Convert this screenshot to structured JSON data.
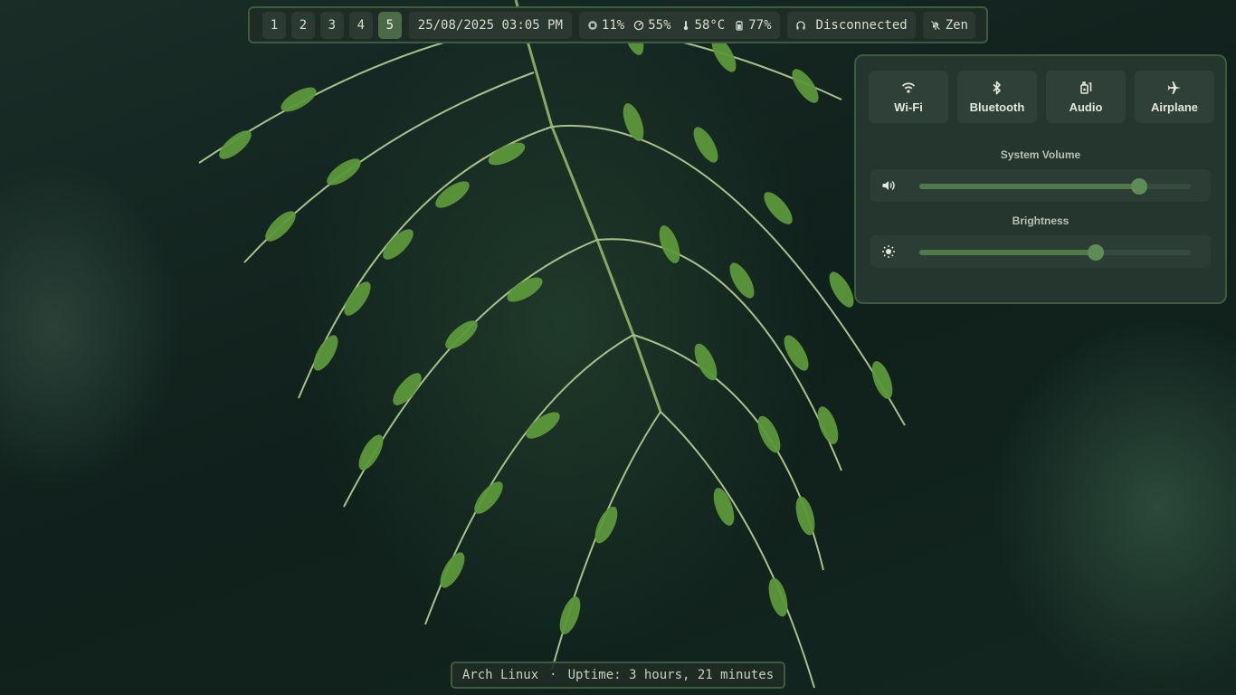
{
  "workspaces": [
    {
      "label": "1",
      "active": false
    },
    {
      "label": "2",
      "active": false
    },
    {
      "label": "3",
      "active": false
    },
    {
      "label": "4",
      "active": false
    },
    {
      "label": "5",
      "active": true
    }
  ],
  "clock": "25/08/2025 03:05 PM",
  "stats": {
    "cpu": {
      "icon": "cpu-icon",
      "value": "11%"
    },
    "memory": {
      "icon": "gauge-icon",
      "value": "55%"
    },
    "temperature": {
      "icon": "thermometer-icon",
      "value": "58°C"
    },
    "battery": {
      "icon": "battery-icon",
      "value": "77%"
    }
  },
  "headset": {
    "icon": "headphones-icon",
    "label": "Disconnected"
  },
  "notifications": {
    "icon": "bell-off-icon",
    "label": "Zen"
  },
  "quick_settings": {
    "toggles": [
      {
        "icon": "wifi-icon",
        "label": "Wi-Fi"
      },
      {
        "icon": "bluetooth-icon",
        "label": "Bluetooth"
      },
      {
        "icon": "audio-icon",
        "label": "Audio"
      },
      {
        "icon": "airplane-icon",
        "label": "Airplane"
      }
    ],
    "volume": {
      "title": "System Volume",
      "icon": "speaker-icon",
      "value": 0.81
    },
    "brightness": {
      "title": "Brightness",
      "icon": "sun-icon",
      "value": 0.65
    }
  },
  "bottom": {
    "os": "Arch Linux",
    "separator": "·",
    "uptime": "Uptime: 3 hours, 21 minutes"
  },
  "colors": {
    "accent": "#4f7a48",
    "bar_border": "#3e5a3f",
    "bar_bg": "#1e2c25",
    "active_workspace": "#4a6b46"
  }
}
